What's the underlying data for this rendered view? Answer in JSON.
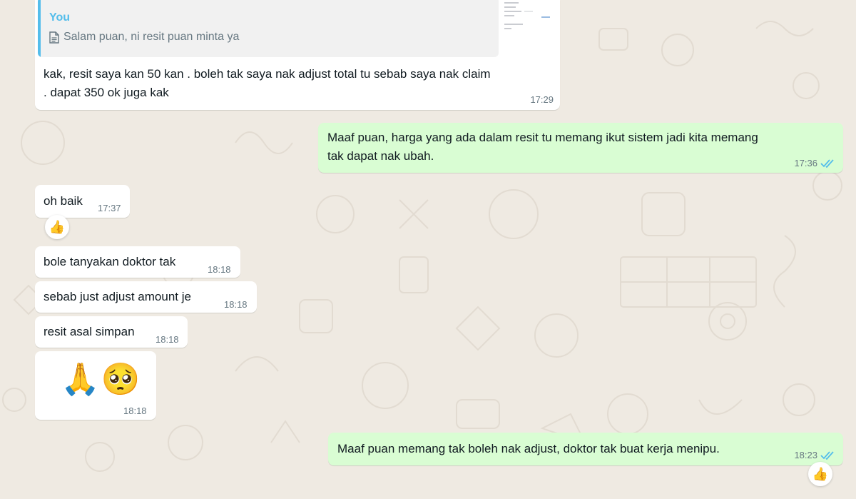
{
  "messages": [
    {
      "id": "m1",
      "direction": "incoming",
      "quote": {
        "author": "You",
        "text": "Salam puan, ni resit puan minta ya"
      },
      "text_line1": "kak, resit saya kan 50 kan . boleh tak saya nak adjust total tu sebab saya nak claim",
      "text_line2": ". dapat 350 ok juga kak",
      "time": "17:29"
    },
    {
      "id": "m2",
      "direction": "outgoing",
      "text_line1": "Maaf puan, harga yang ada dalam resit tu memang ikut sistem jadi kita memang",
      "text_line2": "tak dapat nak ubah.",
      "time": "17:36",
      "status": "read"
    },
    {
      "id": "m3",
      "direction": "incoming",
      "text": "oh baik",
      "time": "17:37",
      "reaction": "👍"
    },
    {
      "id": "m4",
      "direction": "incoming",
      "text": "bole tanyakan doktor tak",
      "time": "18:18"
    },
    {
      "id": "m5",
      "direction": "incoming",
      "text": "sebab just adjust amount je",
      "time": "18:18"
    },
    {
      "id": "m6",
      "direction": "incoming",
      "text": "resit asal simpan",
      "time": "18:18"
    },
    {
      "id": "m7",
      "direction": "incoming",
      "emoji": "🙏🥺",
      "time": "18:18"
    },
    {
      "id": "m8",
      "direction": "outgoing",
      "text": "Maaf puan memang tak boleh nak adjust, doktor tak buat kerja menipu.",
      "time": "18:23",
      "status": "read",
      "reaction": "👍"
    }
  ],
  "colors": {
    "background": "#efeae2",
    "incoming_bubble": "#ffffff",
    "outgoing_bubble": "#d9fdd3",
    "read_ticks": "#53bdeb",
    "quote_accent": "#53bdeb",
    "timestamp": "#667781"
  },
  "icons": {
    "quote_document": "document-icon",
    "read_status": "double-check-icon"
  }
}
